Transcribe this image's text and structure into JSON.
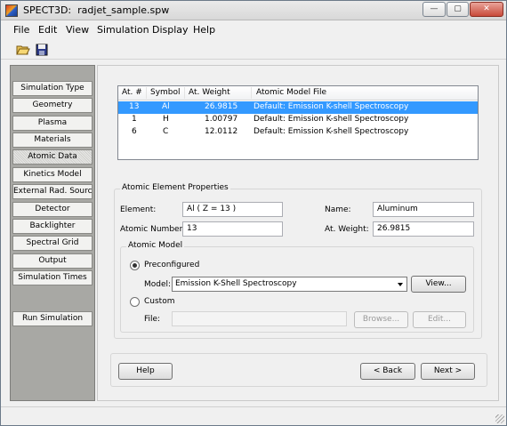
{
  "window": {
    "app_name": "SPECT3D:",
    "file_name": "radjet_sample.spw",
    "min_glyph": "—",
    "max_glyph": "▢",
    "close_glyph": "✕"
  },
  "menu": [
    "File",
    "Edit",
    "View",
    "Simulation",
    "Display",
    "Help"
  ],
  "toolbar": {
    "open_icon": "open-folder-icon",
    "save_icon": "save-disk-icon"
  },
  "sidebar": {
    "items": [
      "Simulation Type",
      "Geometry",
      "Plasma",
      "Materials",
      "Atomic Data",
      "Kinetics Model",
      "External Rad. Source",
      "Detector",
      "Backlighter",
      "Spectral Grid",
      "Output",
      "Simulation Times"
    ],
    "active_index": 4,
    "run_label": "Run Simulation"
  },
  "table": {
    "headers": [
      "At. #",
      "Symbol",
      "At. Weight",
      "Atomic Model File"
    ],
    "rows": [
      {
        "num": "13",
        "symbol": "Al",
        "weight": "26.9815",
        "file": "Default:  Emission K-shell Spectroscopy"
      },
      {
        "num": "1",
        "symbol": "H",
        "weight": "1.00797",
        "file": "Default:  Emission K-shell Spectroscopy"
      },
      {
        "num": "6",
        "symbol": "C",
        "weight": "12.0112",
        "file": "Default:  Emission K-shell Spectroscopy"
      }
    ],
    "selected_row": 0
  },
  "props": {
    "title": "Atomic Element Properties",
    "element_label": "Element:",
    "element_value": "Al  ( Z = 13 )",
    "name_label": "Name:",
    "name_value": "Aluminum",
    "atomic_number_label": "Atomic Number:",
    "atomic_number_value": "13",
    "weight_label": "At. Weight:",
    "weight_value": "26.9815"
  },
  "model": {
    "title": "Atomic Model",
    "preconfigured_label": "Preconfigured",
    "model_label": "Model:",
    "model_value": "Emission K-Shell Spectroscopy",
    "view_button": "View...",
    "custom_label": "Custom",
    "file_label": "File:",
    "file_value": "",
    "browse_button": "Browse...",
    "edit_button": "Edit..."
  },
  "nav": {
    "help": "Help",
    "back": "< Back",
    "next": "Next >"
  }
}
